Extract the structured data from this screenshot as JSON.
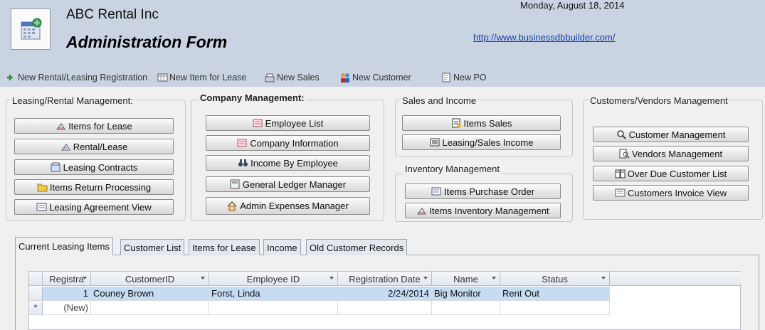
{
  "header": {
    "company": "ABC Rental Inc",
    "form_title": "Administration Form",
    "date": "Monday, August 18, 2014",
    "website": "http://www.businessdbbuilder.com/"
  },
  "toolbar": {
    "new_rental": "New Rental/Leasing Registration",
    "new_item": "New Item for Lease",
    "new_sales": "New Sales",
    "new_customer": "New Customer",
    "new_po": "New PO"
  },
  "leasing": {
    "title": "Leasing/Rental Management:",
    "items_for_lease": "Items for Lease",
    "rental_lease": "Rental/Lease",
    "leasing_contracts": "Leasing Contracts",
    "items_return": "Items Return Processing",
    "leasing_agreement": "Leasing Agreement View"
  },
  "company": {
    "title": "Company Management:",
    "employee_list": "Employee List",
    "company_info": "Company Information",
    "income_by_employee": "Income By Employee",
    "general_ledger": "General Ledger Manager",
    "admin_expenses": "Admin Expenses Manager"
  },
  "sales": {
    "title": "Sales and Income",
    "items_sales": "Items Sales",
    "leasing_sales_income": "Leasing/Sales Income"
  },
  "inventory": {
    "title": "Inventory Management",
    "purchase_order": "Items Purchase Order",
    "inventory_mgmt": "Items Inventory Management"
  },
  "customers": {
    "title": "Customers/Vendors Management",
    "customer_mgmt": "Customer Management",
    "vendors_mgmt": "Vendors Management",
    "overdue": "Over Due Customer List",
    "invoice_view": "Customers Invoice View"
  },
  "tabs": {
    "current": "Current Leasing Items",
    "customer_list": "Customer List",
    "items_for_lease": "Items for Lease",
    "income": "Income",
    "old_records": "Old Customer Records"
  },
  "grid": {
    "columns": [
      "Registra",
      "CustomerID",
      "Employee ID",
      "Registration Date",
      "Name",
      "Status"
    ],
    "rows": [
      [
        "1",
        "Couney Brown",
        "Forst, Linda",
        "2/24/2014",
        "Big Monitor",
        "Rent Out"
      ]
    ],
    "new_row_marker": "*",
    "new_row_label": "(New)"
  }
}
